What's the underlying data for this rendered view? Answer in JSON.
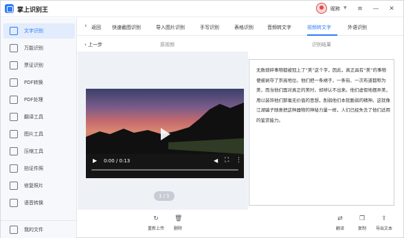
{
  "app": {
    "title": "掌上识别王"
  },
  "user": {
    "name": "昵称"
  },
  "window": {
    "minimize": "—",
    "maximize": "☐",
    "close": "✕"
  },
  "sidebar": {
    "items": [
      {
        "label": "文字识别",
        "icon": "text-recognition-icon",
        "active": true
      },
      {
        "label": "万能识别",
        "icon": "universal-recognition-icon"
      },
      {
        "label": "票证识别",
        "icon": "ticket-recognition-icon"
      },
      {
        "label": "PDF转换",
        "icon": "pdf-convert-icon"
      },
      {
        "label": "PDF处理",
        "icon": "pdf-process-icon"
      },
      {
        "label": "翻译工具",
        "icon": "translate-icon"
      },
      {
        "label": "图片工具",
        "icon": "image-tool-icon"
      },
      {
        "label": "压缩工具",
        "icon": "compress-icon"
      },
      {
        "label": "拍证件照",
        "icon": "id-photo-icon"
      },
      {
        "label": "修复照片",
        "icon": "repair-photo-icon"
      },
      {
        "label": "语音转换",
        "icon": "voice-convert-icon"
      }
    ],
    "bottom": {
      "label": "我的文件",
      "icon": "my-files-icon"
    }
  },
  "tabs": {
    "back_label": "返回",
    "items": [
      {
        "label": "快速截图识别"
      },
      {
        "label": "导入图片识别"
      },
      {
        "label": "手写识别"
      },
      {
        "label": "表格识别"
      },
      {
        "label": "音频转文字"
      },
      {
        "label": "视频转文字",
        "active": true
      },
      {
        "label": "外语识别"
      }
    ]
  },
  "subheader": {
    "back_label": "上一步",
    "original_label": "原视频",
    "result_label": "识别结果"
  },
  "video": {
    "time": "0:00 / 0:13",
    "play_icon": "play-icon",
    "volume_icon": "volume-icon",
    "fullscreen_icon": "fullscreen-icon",
    "more_icon": "more-icon"
  },
  "pager": {
    "text": "1 / 1"
  },
  "result": {
    "text": "无数琐碎事物都被冠上了“美”这个字，因此，真正具有“美”的事物便被剥夺了崇高地位。他们把一条裙子，一条街、一次布道都称为美，而当他们面对真正的美时，却辨认不出来。他们虚假地摆弄美，用以装饰他们那毫无价值的思想，削弱他们本就脆弱的精神。这就像江湖骗子随意把这种器物的神秘力量一样，人们已经失去了他们适用的鉴赏能力。"
  },
  "toolbar": {
    "reupload": "重新上传",
    "delete": "删除",
    "translate": "翻译",
    "copy": "复制",
    "export": "导出文本"
  }
}
